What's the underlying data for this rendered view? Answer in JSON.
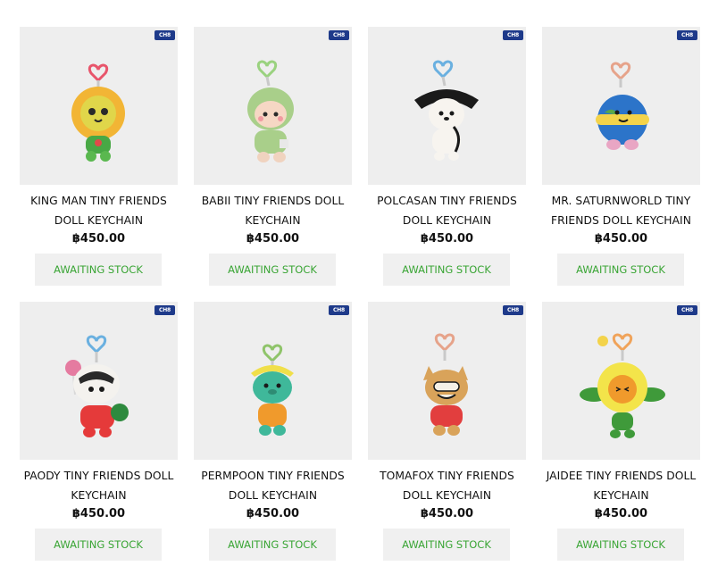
{
  "badge_label": "CH8",
  "accent_color": "#3aa535",
  "products": [
    {
      "name": "KING MAN TINY FRIENDS DOLL KEYCHAIN",
      "price": "฿450.00",
      "stock_label": "AWAITING STOCK",
      "image": "king-man-doll-image"
    },
    {
      "name": "BABII TINY FRIENDS DOLL KEYCHAIN",
      "price": "฿450.00",
      "stock_label": "AWAITING STOCK",
      "image": "babii-doll-image"
    },
    {
      "name": "POLCASAN TINY FRIENDS DOLL KEYCHAIN",
      "price": "฿450.00",
      "stock_label": "AWAITING STOCK",
      "image": "polcasan-doll-image"
    },
    {
      "name": "MR. SATURNWORLD TINY FRIENDS DOLL KEYCHAIN",
      "price": "฿450.00",
      "stock_label": "AWAITING STOCK",
      "image": "mr-saturnworld-doll-image"
    },
    {
      "name": "PAODY TINY FRIENDS DOLL KEYCHAIN",
      "price": "฿450.00",
      "stock_label": "AWAITING STOCK",
      "image": "paody-doll-image"
    },
    {
      "name": "PERMPOON TINY FRIENDS DOLL KEYCHAIN",
      "price": "฿450.00",
      "stock_label": "AWAITING STOCK",
      "image": "permpoon-doll-image"
    },
    {
      "name": "TOMAFOX TINY FRIENDS DOLL KEYCHAIN",
      "price": "฿450.00",
      "stock_label": "AWAITING STOCK",
      "image": "tomafox-doll-image"
    },
    {
      "name": "JAIDEE TINY FRIENDS DOLL KEYCHAIN",
      "price": "฿450.00",
      "stock_label": "AWAITING STOCK",
      "image": "jaidee-doll-image"
    }
  ]
}
